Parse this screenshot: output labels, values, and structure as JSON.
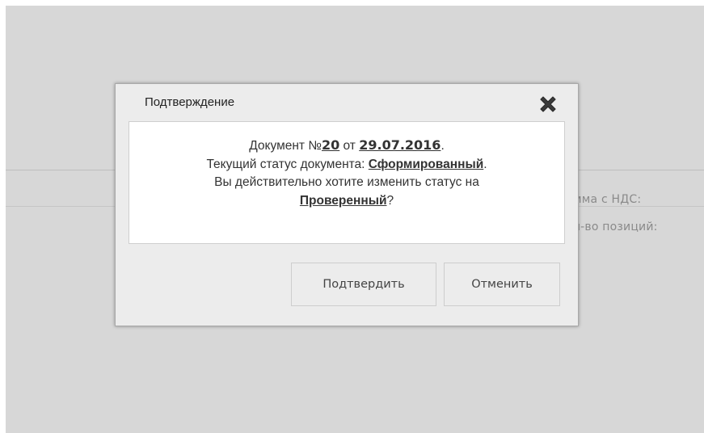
{
  "background": {
    "line1_text": "мма с НДС:",
    "line2_text": "л-во позиций:"
  },
  "dialog": {
    "title": "Подтверждение",
    "close_icon": "close-x-icon",
    "message": {
      "doc_prefix": "Документ №",
      "doc_number": "20",
      "doc_from": " от ",
      "doc_date": "29.07.2016",
      "doc_suffix": ".",
      "status_prefix": "Текущий статус документа: ",
      "current_status": "Сформированный",
      "status_suffix": ".",
      "question_prefix": "Вы действительно хотите изменить статус на",
      "new_status": "Проверенный",
      "question_suffix": "?"
    },
    "confirm_label": "Подтвердить",
    "cancel_label": "Отменить"
  }
}
